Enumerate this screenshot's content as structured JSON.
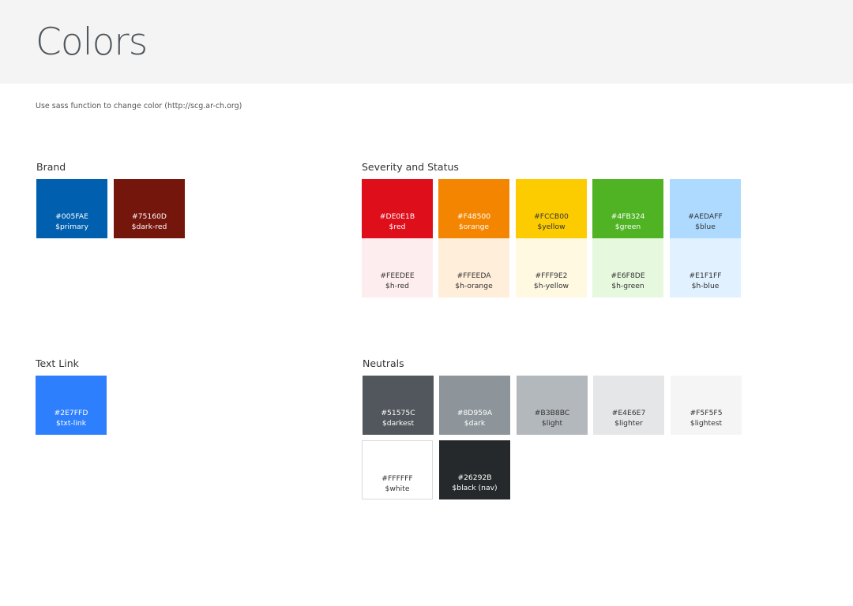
{
  "header": {
    "title": "Colors"
  },
  "note": "Use sass function to change color (http://scg.ar-ch.org)",
  "sections": {
    "brand": {
      "title": "Brand",
      "swatches": [
        {
          "hex": "#005FAE",
          "name": "$primary",
          "color": "#005FAE"
        },
        {
          "hex": "#75160D",
          "name": "$dark-red",
          "color": "#75160D"
        }
      ]
    },
    "severity": {
      "title": "Severity and Status",
      "swatches": [
        {
          "hex": "#DE0E1B",
          "name": "$red",
          "color": "#DE0E1B"
        },
        {
          "hex": "#F48500",
          "name": "$orange",
          "color": "#F48500"
        },
        {
          "hex": "#FCCB00",
          "name": "$yellow",
          "color": "#FCCB00"
        },
        {
          "hex": "#4FB324",
          "name": "$green",
          "color": "#4FB324"
        },
        {
          "hex": "#AEDAFF",
          "name": "$blue",
          "color": "#AEDAFF"
        },
        {
          "hex": "#FEEDEE",
          "name": "$h-red",
          "color": "#FEEDEE"
        },
        {
          "hex": "#FFEEDA",
          "name": "$h-orange",
          "color": "#FFEEDA"
        },
        {
          "hex": "#FFF9E2",
          "name": "$h-yellow",
          "color": "#FFF9E2"
        },
        {
          "hex": "#E6F8DE",
          "name": "$h-green",
          "color": "#E6F8DE"
        },
        {
          "hex": "#E1F1FF",
          "name": "$h-blue",
          "color": "#E1F1FF"
        }
      ]
    },
    "textlink": {
      "title": "Text Link",
      "swatches": [
        {
          "hex": "#2E7FFD",
          "name": "$txt-link",
          "color": "#2E7FFD"
        }
      ]
    },
    "neutrals": {
      "title": "Neutrals",
      "swatches": [
        {
          "hex": "#51575C",
          "name": "$darkest",
          "color": "#51575C"
        },
        {
          "hex": "#8D959A",
          "name": "$dark",
          "color": "#8D959A"
        },
        {
          "hex": "#B3B8BC",
          "name": "$light",
          "color": "#B3B8BC"
        },
        {
          "hex": "#E4E6E7",
          "name": "$lighter",
          "color": "#E4E6E7"
        },
        {
          "hex": "#F5F5F5",
          "name": "$lightest",
          "color": "#F5F5F5"
        },
        {
          "hex": "#FFFFFF",
          "name": "$white",
          "color": "#FFFFFF"
        },
        {
          "hex": "#26292B",
          "name": "$black (nav)",
          "color": "#26292B"
        }
      ]
    }
  }
}
